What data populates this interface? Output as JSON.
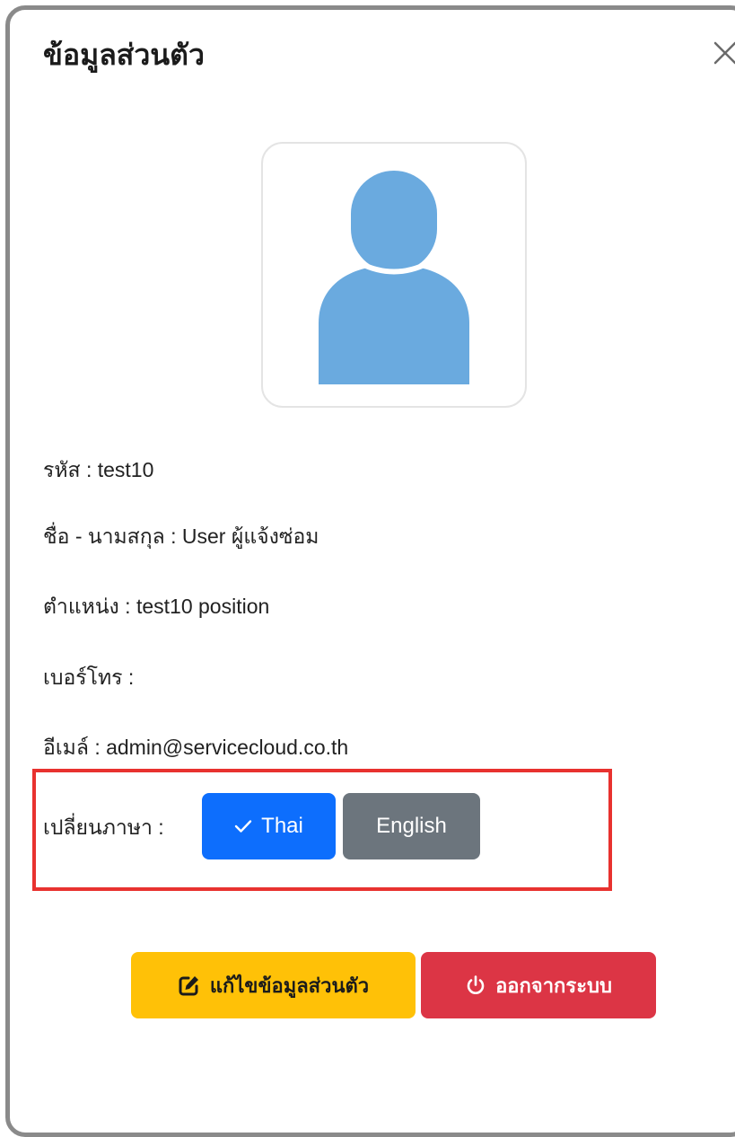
{
  "modal": {
    "title": "ข้อมูลส่วนตัว",
    "close_icon": "close-icon"
  },
  "profile": {
    "avatar_icon": "user-avatar-icon",
    "avatar_color": "#6aaadf",
    "code": "รหัส : test10",
    "full_name": "ชื่อ - นามสกุล : User ผู้แจ้งซ่อม",
    "position": "ตำแหน่ง : test10 position",
    "phone": "เบอร์โทร :",
    "email": "อีเมล์ : admin@servicecloud.co.th"
  },
  "language": {
    "label": "เปลี่ยนภาษา :",
    "options": [
      {
        "label": "Thai",
        "selected": true,
        "icon": "check-icon",
        "color": "#0d6efd"
      },
      {
        "label": "English",
        "selected": false,
        "color": "#6c757d"
      }
    ],
    "highlight_color": "#e8322f"
  },
  "actions": {
    "edit_label": "แก้ไขข้อมูลส่วนตัว",
    "edit_icon": "edit-icon",
    "edit_color": "#ffc107",
    "logout_label": "ออกจากระบบ",
    "logout_icon": "power-icon",
    "logout_color": "#dc3545"
  }
}
